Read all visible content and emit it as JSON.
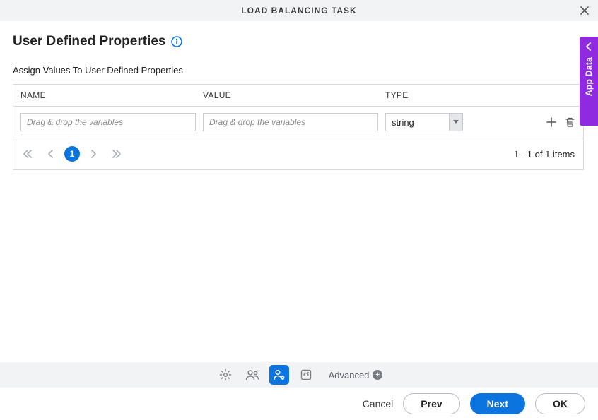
{
  "header": {
    "title": "LOAD BALANCING TASK"
  },
  "page": {
    "title": "User Defined Properties",
    "subtitle": "Assign Values To User Defined Properties"
  },
  "table": {
    "columns": {
      "name": "NAME",
      "value": "VALUE",
      "type": "TYPE"
    },
    "rows": [
      {
        "name_placeholder": "Drag & drop the variables",
        "value_placeholder": "Drag & drop the variables",
        "type": "string"
      }
    ]
  },
  "pager": {
    "current_page": "1",
    "info": "1 - 1 of 1 items"
  },
  "sidebar": {
    "label": "App Data"
  },
  "stepbar": {
    "advanced_label": "Advanced"
  },
  "footer": {
    "cancel": "Cancel",
    "prev": "Prev",
    "next": "Next",
    "ok": "OK"
  },
  "colors": {
    "accent": "#0c74df",
    "purple": "#8f2ae0"
  }
}
